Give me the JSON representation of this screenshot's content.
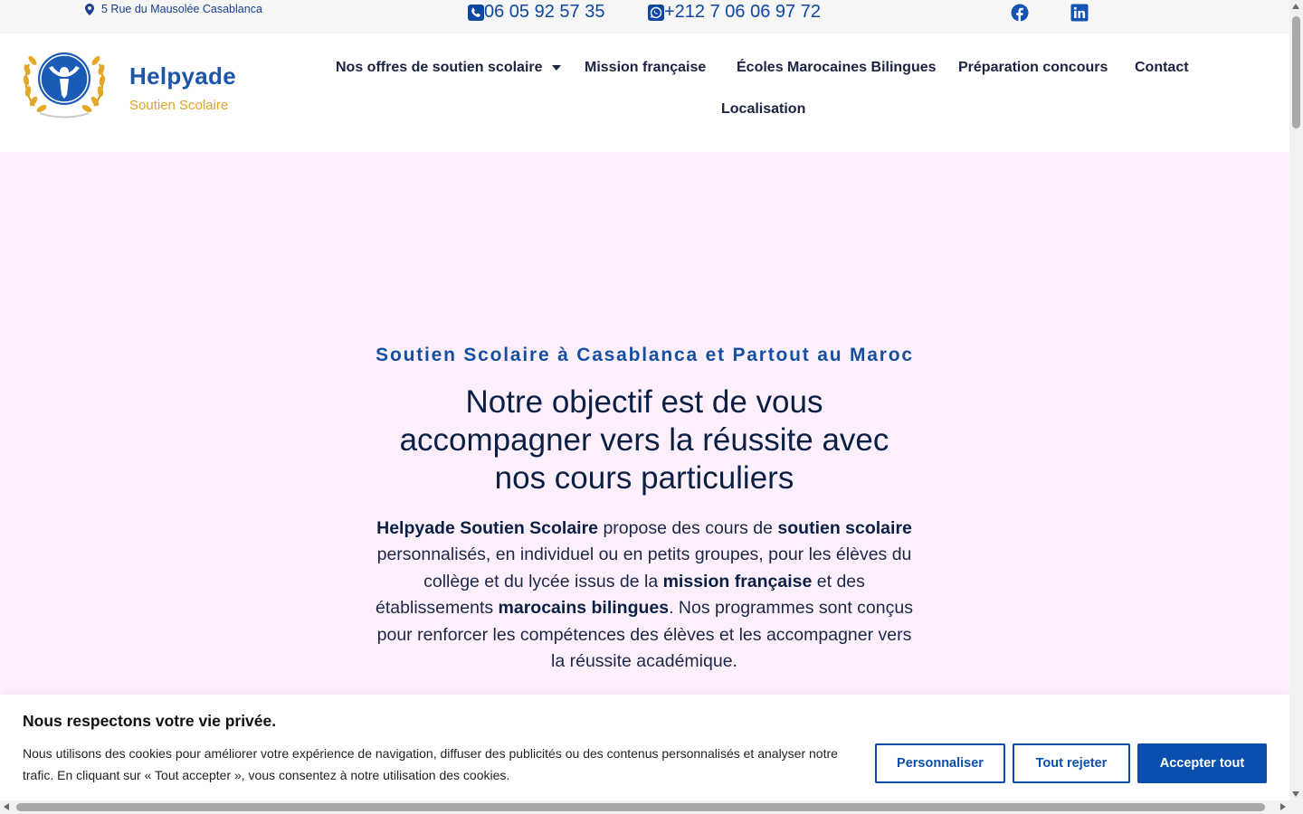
{
  "topbar": {
    "address": "5 Rue du Mausolée Casablanca",
    "phone": "06 05 92 57 35",
    "whatsapp": "+212 7 06 06 97 72",
    "social": [
      "facebook-icon",
      "linkedin-icon"
    ]
  },
  "brand": {
    "name": "Helpyade",
    "tagline": "Soutien Scolaire"
  },
  "nav": {
    "items": [
      {
        "label": "Nos offres de soutien scolaire",
        "has_dropdown": true
      },
      {
        "label": "Mission française"
      },
      {
        "label": "Écoles Marocaines Bilingues"
      },
      {
        "label": "Préparation concours"
      },
      {
        "label": "Contact"
      },
      {
        "label": "Localisation"
      }
    ]
  },
  "hero": {
    "kicker": "Soutien Scolaire à Casablanca et Partout au Maroc",
    "headline": "Notre objectif est de vous accompagner vers la réussite avec nos cours particuliers",
    "intro": {
      "b1": "Helpyade Soutien Scolaire",
      "t1": " propose des cours de ",
      "b2": "soutien scolaire",
      "t2": " personnalisés, en individuel ou en petits groupes, pour les élèves du collège et du lycée issus de la ",
      "b3": "mission française",
      "t3": " et des établissements ",
      "b4": "marocains bilingues",
      "t4": ". Nos programmes sont conçus pour renforcer les compétences des élèves et les accompagner vers la réussite académique."
    }
  },
  "cookie": {
    "title": "Nous respectons votre vie privée.",
    "text": "Nous utilisons des cookies pour améliorer votre expérience de navigation, diffuser des publicités ou des contenus personnalisés et analyser notre trafic. En cliquant sur « Tout accepter », vous consentez à notre utilisation des cookies.",
    "customize": "Personnaliser",
    "reject": "Tout rejeter",
    "accept": "Accepter tout"
  },
  "colors": {
    "brand_blue": "#1d56a8",
    "brand_gold": "#e1a425",
    "hero_bg": "#fdf0fc",
    "button_blue": "#0b4fae"
  }
}
